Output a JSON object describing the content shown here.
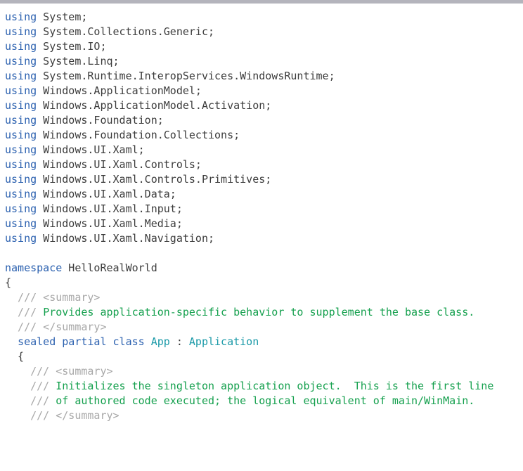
{
  "window": {
    "top_bar_color": "#b4b4bc",
    "background_color": "#ffffff"
  },
  "editor": {
    "language": "C#",
    "colors": {
      "keyword": "#2d62b0",
      "type": "#1b9aa8",
      "plain": "#3c3c3c",
      "comment": "#15a04e",
      "doc_tag": "#a8a8a8"
    },
    "lines": [
      {
        "id": 1,
        "tokens": [
          {
            "t": "using",
            "c": "kw"
          },
          {
            "t": " System;",
            "c": "plain"
          }
        ]
      },
      {
        "id": 2,
        "tokens": [
          {
            "t": "using",
            "c": "kw"
          },
          {
            "t": " System.Collections.Generic;",
            "c": "plain"
          }
        ]
      },
      {
        "id": 3,
        "tokens": [
          {
            "t": "using",
            "c": "kw"
          },
          {
            "t": " System.IO;",
            "c": "plain"
          }
        ]
      },
      {
        "id": 4,
        "tokens": [
          {
            "t": "using",
            "c": "kw"
          },
          {
            "t": " System.Linq;",
            "c": "plain"
          }
        ]
      },
      {
        "id": 5,
        "tokens": [
          {
            "t": "using",
            "c": "kw"
          },
          {
            "t": " System.Runtime.InteropServices.WindowsRuntime;",
            "c": "plain"
          }
        ]
      },
      {
        "id": 6,
        "tokens": [
          {
            "t": "using",
            "c": "kw"
          },
          {
            "t": " Windows.ApplicationModel;",
            "c": "plain"
          }
        ]
      },
      {
        "id": 7,
        "tokens": [
          {
            "t": "using",
            "c": "kw"
          },
          {
            "t": " Windows.ApplicationModel.Activation;",
            "c": "plain"
          }
        ]
      },
      {
        "id": 8,
        "tokens": [
          {
            "t": "using",
            "c": "kw"
          },
          {
            "t": " Windows.Foundation;",
            "c": "plain"
          }
        ]
      },
      {
        "id": 9,
        "tokens": [
          {
            "t": "using",
            "c": "kw"
          },
          {
            "t": " Windows.Foundation.Collections;",
            "c": "plain"
          }
        ]
      },
      {
        "id": 10,
        "tokens": [
          {
            "t": "using",
            "c": "kw"
          },
          {
            "t": " Windows.UI.Xaml;",
            "c": "plain"
          }
        ]
      },
      {
        "id": 11,
        "tokens": [
          {
            "t": "using",
            "c": "kw"
          },
          {
            "t": " Windows.UI.Xaml.Controls;",
            "c": "plain"
          }
        ]
      },
      {
        "id": 12,
        "tokens": [
          {
            "t": "using",
            "c": "kw"
          },
          {
            "t": " Windows.UI.Xaml.Controls.Primitives;",
            "c": "plain"
          }
        ]
      },
      {
        "id": 13,
        "tokens": [
          {
            "t": "using",
            "c": "kw"
          },
          {
            "t": " Windows.UI.Xaml.Data;",
            "c": "plain"
          }
        ]
      },
      {
        "id": 14,
        "tokens": [
          {
            "t": "using",
            "c": "kw"
          },
          {
            "t": " Windows.UI.Xaml.Input;",
            "c": "plain"
          }
        ]
      },
      {
        "id": 15,
        "tokens": [
          {
            "t": "using",
            "c": "kw"
          },
          {
            "t": " Windows.UI.Xaml.Media;",
            "c": "plain"
          }
        ]
      },
      {
        "id": 16,
        "tokens": [
          {
            "t": "using",
            "c": "kw"
          },
          {
            "t": " Windows.UI.Xaml.Navigation;",
            "c": "plain"
          }
        ]
      },
      {
        "id": 17,
        "tokens": []
      },
      {
        "id": 18,
        "tokens": [
          {
            "t": "namespace",
            "c": "kw"
          },
          {
            "t": " HelloRealWorld",
            "c": "plain"
          }
        ]
      },
      {
        "id": 19,
        "tokens": [
          {
            "t": "{",
            "c": "punct"
          }
        ]
      },
      {
        "id": 20,
        "tokens": [
          {
            "t": "  /// <summary>",
            "c": "doctag"
          }
        ]
      },
      {
        "id": 21,
        "tokens": [
          {
            "t": "  /// ",
            "c": "doctag"
          },
          {
            "t": "Provides application-specific behavior to supplement the base class.",
            "c": "comment"
          }
        ]
      },
      {
        "id": 22,
        "tokens": [
          {
            "t": "  /// </summary>",
            "c": "doctag"
          }
        ]
      },
      {
        "id": 23,
        "tokens": [
          {
            "t": "  ",
            "c": "plain"
          },
          {
            "t": "sealed partial class",
            "c": "kw"
          },
          {
            "t": " ",
            "c": "plain"
          },
          {
            "t": "App",
            "c": "type"
          },
          {
            "t": " : ",
            "c": "punct"
          },
          {
            "t": "Application",
            "c": "type"
          }
        ]
      },
      {
        "id": 24,
        "tokens": [
          {
            "t": "  {",
            "c": "punct"
          }
        ]
      },
      {
        "id": 25,
        "tokens": [
          {
            "t": "    /// <summary>",
            "c": "doctag"
          }
        ]
      },
      {
        "id": 26,
        "tokens": [
          {
            "t": "    /// ",
            "c": "doctag"
          },
          {
            "t": "Initializes the singleton application object.  This is the first line",
            "c": "comment"
          }
        ]
      },
      {
        "id": 27,
        "tokens": [
          {
            "t": "    /// ",
            "c": "doctag"
          },
          {
            "t": "of authored code executed; the logical equivalent of main/WinMain.",
            "c": "comment"
          }
        ]
      },
      {
        "id": 28,
        "tokens": [
          {
            "t": "    /// </summary>",
            "c": "doctag"
          }
        ]
      }
    ]
  }
}
